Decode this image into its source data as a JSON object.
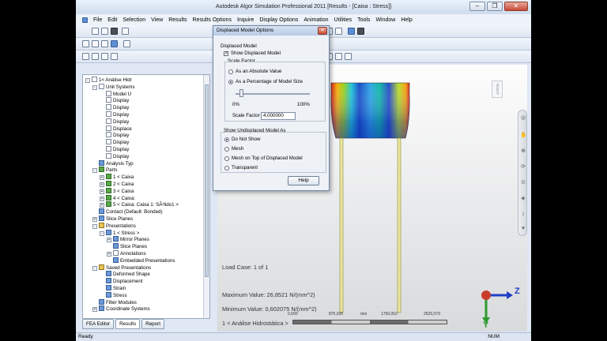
{
  "window": {
    "title": "Autodesk Algor Simulation Professional 2011     [Results - [Caixa : Stress]]",
    "minimize": "–",
    "restore": "❐",
    "close": "✕"
  },
  "menubar": {
    "items": [
      "File",
      "Edit",
      "Selection",
      "View",
      "Results",
      "Results Options",
      "Inquire",
      "Display Options",
      "Animation",
      "Utilities",
      "Tools",
      "Window",
      "Help"
    ]
  },
  "tree": {
    "items": [
      {
        "text": "1< Análise Hidr",
        "indent": 0,
        "icon": "doc",
        "exp": "-"
      },
      {
        "text": "Unit Systems",
        "indent": 1,
        "icon": "doc",
        "exp": "-"
      },
      {
        "text": "Model U",
        "indent": 2,
        "icon": "doc",
        "exp": ""
      },
      {
        "text": "Display",
        "indent": 2,
        "icon": "doc",
        "exp": ""
      },
      {
        "text": "Display",
        "indent": 2,
        "icon": "doc",
        "exp": ""
      },
      {
        "text": "Display",
        "indent": 2,
        "icon": "doc",
        "exp": ""
      },
      {
        "text": "Display",
        "indent": 2,
        "icon": "doc",
        "exp": ""
      },
      {
        "text": "Displace",
        "indent": 2,
        "icon": "doc",
        "exp": ""
      },
      {
        "text": "Display",
        "indent": 2,
        "icon": "doc",
        "exp": ""
      },
      {
        "text": "Display",
        "indent": 2,
        "icon": "doc",
        "exp": ""
      },
      {
        "text": "Display",
        "indent": 2,
        "icon": "doc",
        "exp": ""
      },
      {
        "text": "Display",
        "indent": 2,
        "icon": "doc",
        "exp": ""
      },
      {
        "text": "Analysis Typ",
        "indent": 1,
        "icon": "blu",
        "exp": ""
      },
      {
        "text": "Parts",
        "indent": 1,
        "icon": "grn",
        "exp": "-"
      },
      {
        "text": "1 < Caixa",
        "indent": 2,
        "icon": "grn",
        "exp": "+"
      },
      {
        "text": "2 < Caixa",
        "indent": 2,
        "icon": "grn",
        "exp": "+"
      },
      {
        "text": "3 < Caixa",
        "indent": 2,
        "icon": "grn",
        "exp": "+"
      },
      {
        "text": "4 < Caixa:",
        "indent": 2,
        "icon": "grn",
        "exp": "+"
      },
      {
        "text": "5 < Caixa: Caixa 1: SÃ³lido1 >",
        "indent": 2,
        "icon": "grn",
        "exp": "+"
      },
      {
        "text": "Contact (Default: Bonded)",
        "indent": 1,
        "icon": "blu",
        "exp": ""
      },
      {
        "text": "Slice Planes",
        "indent": 1,
        "icon": "blu",
        "exp": "+"
      },
      {
        "text": "Presentations",
        "indent": 1,
        "icon": "yel",
        "exp": "-"
      },
      {
        "text": "1 < Stress >",
        "indent": 2,
        "icon": "blu",
        "exp": "-"
      },
      {
        "text": "Mirror Planes",
        "indent": 3,
        "icon": "blu",
        "exp": "+"
      },
      {
        "text": "Slice Planes",
        "indent": 3,
        "icon": "blu",
        "exp": ""
      },
      {
        "text": "Annotations",
        "indent": 3,
        "icon": "doc",
        "exp": "+"
      },
      {
        "text": "Embedded Presentations",
        "indent": 3,
        "icon": "blu",
        "exp": ""
      },
      {
        "text": "Saved Presentations",
        "indent": 1,
        "icon": "yel",
        "exp": "-"
      },
      {
        "text": "Deformed Shape",
        "indent": 2,
        "icon": "blu",
        "exp": ""
      },
      {
        "text": "Displacement",
        "indent": 2,
        "icon": "blu",
        "exp": ""
      },
      {
        "text": "Strain",
        "indent": 2,
        "icon": "blu",
        "exp": ""
      },
      {
        "text": "Stress",
        "indent": 2,
        "icon": "blu",
        "exp": ""
      },
      {
        "text": "Filter Modules",
        "indent": 1,
        "icon": "blu",
        "exp": ""
      },
      {
        "text": "Coordinate Systems",
        "indent": 1,
        "icon": "blu",
        "exp": "+"
      }
    ]
  },
  "tabs": [
    {
      "label": "FEA Editor",
      "active": false
    },
    {
      "label": "Results",
      "active": true
    },
    {
      "label": "Report",
      "active": false
    }
  ],
  "dialog": {
    "title": "Displaced Model Options",
    "close": "✕",
    "section_displaced": "Displaced Model",
    "show_displaced": "Show Displaced Model",
    "scale_factor_group": "Scale Factor",
    "opt_absolute": "As an Absolute Value",
    "opt_percentage": "As a Percentage of Model Size",
    "slider_min": "0%",
    "slider_max": "100%",
    "slider_value": 0.05,
    "scale_factor_label": "Scale Factor",
    "scale_factor_value": "4,000000",
    "section_undisplaced": "Show Undisplaced Model As",
    "opt_do_not_show": "Do Not Show",
    "opt_mesh": "Mesh",
    "opt_mesh_top": "Mesh on Top of Displaced Model",
    "opt_transparent": "Transparent",
    "help": "Help"
  },
  "viewport": {
    "viewcube_label": "RIGHT",
    "load_case": "Load Case:  1 of 1",
    "max_value": "Maximum Value: 26,8521 N/(mm^2)",
    "min_value": "Minimum Value: 0,602075 N/(mm^2)",
    "study": "1 < Análise Hidrostática >",
    "scale_ticks": [
      "0,000",
      "875,026",
      "mm",
      "1750,052",
      "2625,079"
    ],
    "axis_z": "Z",
    "axis_y": "Y"
  },
  "status": {
    "ready": "Ready",
    "num": "NUM"
  }
}
